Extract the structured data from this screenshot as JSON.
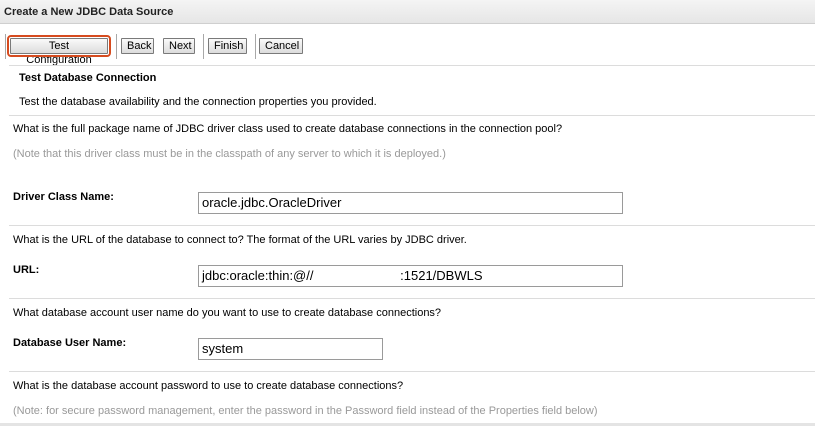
{
  "window": {
    "title": "Create a New JDBC Data Source"
  },
  "toolbar": {
    "test_label": "Test Configuration",
    "back_label": "Back",
    "next_label": "Next",
    "finish_label": "Finish",
    "cancel_label": "Cancel"
  },
  "section": {
    "title": "Test Database Connection",
    "description": "Test the database availability and the connection properties you provided."
  },
  "driver": {
    "question": "What is the full package name of JDBC driver class used to create database connections in the connection pool?",
    "note": "(Note that this driver class must be in the classpath of any server to which it is deployed.)",
    "label": "Driver Class Name:",
    "value": "oracle.jdbc.OracleDriver"
  },
  "url": {
    "question": "What is the URL of the database to connect to? The format of the URL varies by JDBC driver.",
    "label": "URL:",
    "value": "jdbc:oracle:thin:@//                        :1521/DBWLS"
  },
  "user": {
    "question": "What database account user name do you want to use to create database connections?",
    "label": "Database User Name:",
    "value": "system"
  },
  "password": {
    "question": "What is the database account password to use to create database connections?",
    "note": "(Note: for secure password management, enter the password in the Password field instead of the Properties field below)"
  }
}
